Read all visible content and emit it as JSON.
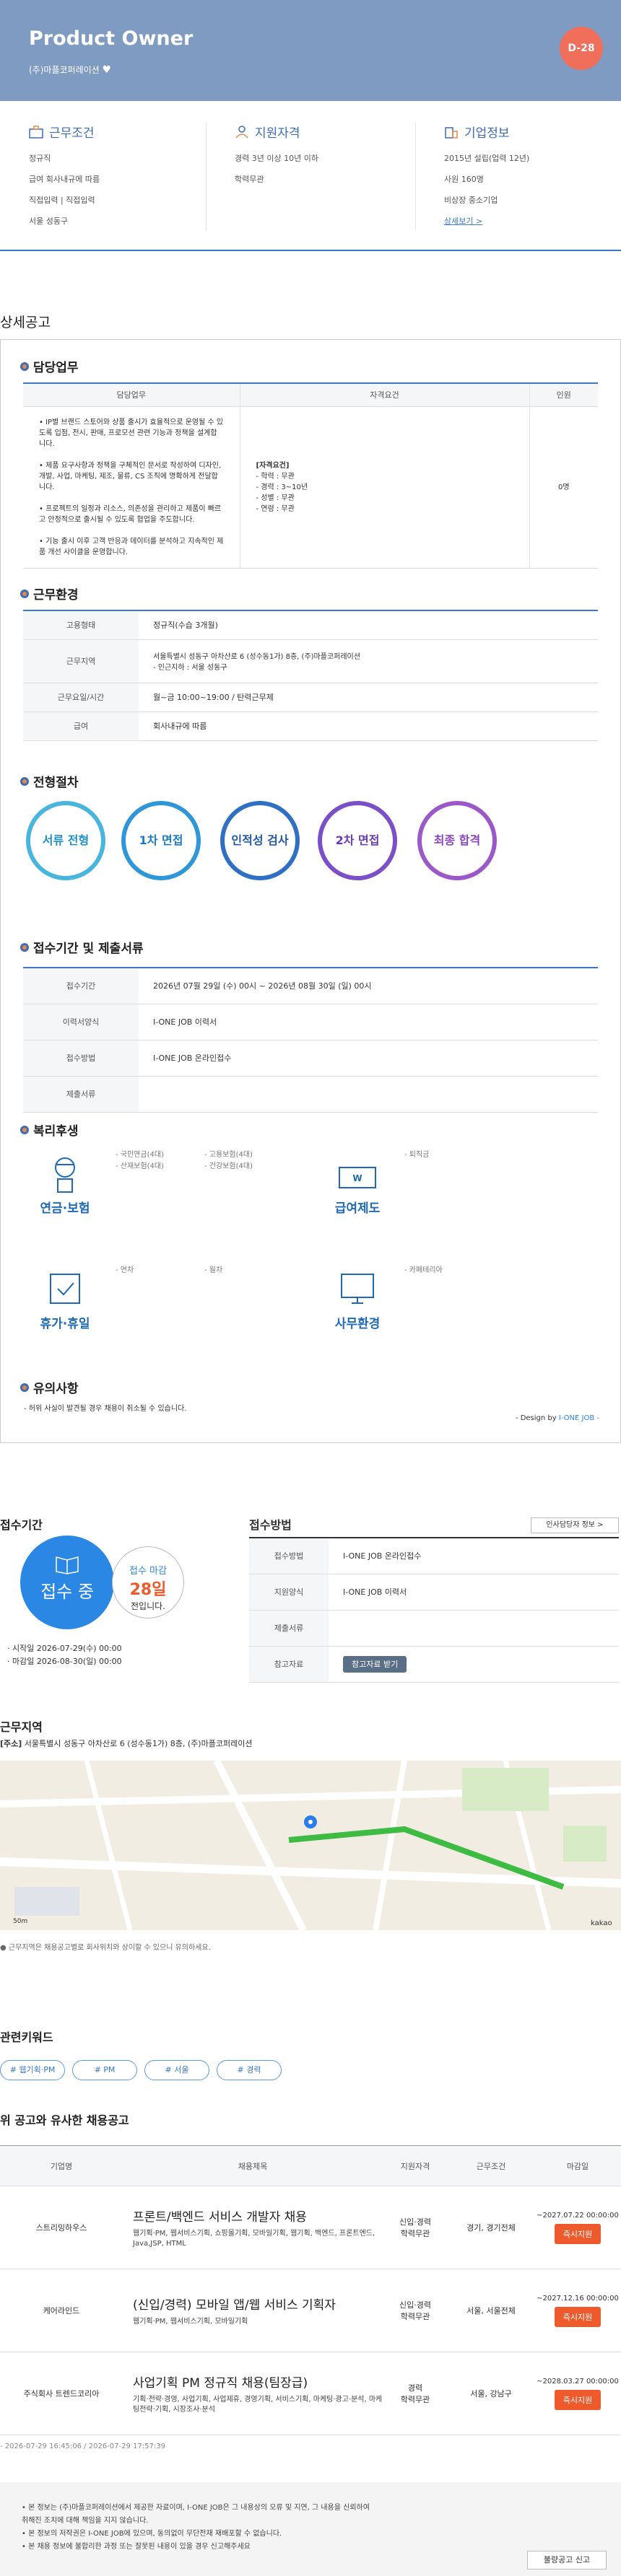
{
  "header": {
    "title": "Product Owner",
    "company": "(주)마플코퍼레이션",
    "dday": "D-28"
  },
  "info": {
    "work": {
      "title": "근무조건",
      "items": [
        "정규직",
        "급여 회사내규에 따름",
        "직접입력 | 직접입력",
        "서울 성동구"
      ]
    },
    "qual": {
      "title": "지원자격",
      "items": [
        "경력 3년 이상 10년 이하",
        "학력무관"
      ]
    },
    "corp": {
      "title": "기업정보",
      "items": [
        "2015년 설립(업력 12년)",
        "사원 160명",
        "비상장 중소기업"
      ],
      "more": "상세보기 >"
    }
  },
  "detail": {
    "heading": "상세공고",
    "duty": {
      "title": "담당업무",
      "headers": [
        "담당업무",
        "자격요건",
        "인원"
      ],
      "task": [
        "• IP별 브랜드 스토어와 상품 출시가 효율적으로 운영될 수 있도록 입점, 전시, 판매, 프로모션 관련 기능과 정책을 설계합니다.",
        "• 제품 요구사항과 정책을 구체적인 문서로 작성하여 디자인, 개발, 사업, 마케팅, 제조, 물류, CS 조직에 명확하게 전달합니다.",
        "• 프로젝트의 일정과 리소스, 의존성을 관리하고 제품이 빠르고 안정적으로 출시될 수 있도록 협업을 주도합니다.",
        "• 기능 출시 이후 고객 반응과 데이터를 분석하고 지속적인 제품 개선 사이클을 운영합니다."
      ],
      "req": [
        "[자격요건]",
        "- 학력 : 무관",
        "- 경력 : 3~10년",
        "- 성별 : 무관",
        "- 연령 : 무관"
      ],
      "count": "0명"
    },
    "env": {
      "title": "근무환경",
      "rows": [
        [
          "고용형태",
          "정규직(수습 3개월)"
        ],
        [
          "근무지역",
          "서울특별시 성동구 아차산로 6 (성수동1가) 8층, (주)마플코퍼레이션\n- 인근지하 : 서울 성동구"
        ],
        [
          "근무요일/시간",
          "월~금 10:00~19:00 / 탄력근무제"
        ],
        [
          "급여",
          "회사내규에 따름"
        ]
      ]
    },
    "process": {
      "title": "전형절차",
      "steps": [
        "서류 전형",
        "1차 면접",
        "인적성 검사",
        "2차 면접",
        "최종 합격"
      ]
    },
    "period": {
      "title": "접수기간 및 제출서류",
      "rows": [
        [
          "접수기간",
          "2026년 07월 29일 (수) 00시 ~ 2026년 08월 30일 (일) 00시"
        ],
        [
          "이력서양식",
          "I-ONE JOB 이력서"
        ],
        [
          "접수방법",
          "I-ONE JOB 온라인접수"
        ],
        [
          "제출서류",
          ""
        ]
      ]
    },
    "welfare": {
      "title": "복리후생",
      "g1": {
        "label": "연금·보험",
        "items": [
          "- 국민연금(4대)",
          "- 산재보험(4대)",
          "- 고용보험(4대)",
          "- 건강보험(4대)"
        ]
      },
      "g2": {
        "label": "급여제도",
        "items": [
          "- 퇴직금"
        ]
      },
      "g3": {
        "label": "휴가·휴일",
        "items": [
          "- 연차",
          "- 월차"
        ]
      },
      "g4": {
        "label": "사무환경",
        "items": [
          "- 카페테리아"
        ]
      }
    },
    "notice": {
      "title": "유의사항",
      "text": "- 허위 사실이 발견될 경우 채용이 취소될 수 있습니다.",
      "design": "- Design by ",
      "design_brand": "I-ONE JOB -"
    }
  },
  "apply": {
    "title": "접수기간",
    "status": "접수 중",
    "deadline_label": "접수 마감",
    "deadline_days": "28일",
    "deadline_suffix": "전입니다.",
    "start": "· 시작일 2026-07-29(수) 00:00",
    "end": "· 마감일 2026-08-30(일) 00:00",
    "method_title": "접수방법",
    "contact_btn": "인사담당자 정보 >",
    "rows": [
      [
        "접수방법",
        "I-ONE JOB 온라인접수"
      ],
      [
        "지원양식",
        "I-ONE JOB 이력서"
      ],
      [
        "제출서류",
        ""
      ],
      [
        "참고자료",
        "참고자료 받기"
      ]
    ]
  },
  "location": {
    "title": "근무지역",
    "address_tag": "[주소]",
    "address": "서울특별시 성동구 아차산로 6 (성수동1가) 8층, (주)마플코퍼레이션",
    "note": "● 근무지역은 채용공고별로 회사위치와 상이할 수 있으니 유의하세요.",
    "scale": "50m",
    "kakao": "kakao"
  },
  "keywords": {
    "title": "관련키워드",
    "items": [
      "# 웹기획·PM",
      "# PM",
      "# 서울",
      "# 경력"
    ]
  },
  "similar": {
    "title": "위 공고와 유사한 채용공고",
    "headers": [
      "기업명",
      "채용제목",
      "지원자격",
      "근무조건",
      "마감일"
    ],
    "rows": [
      {
        "company": "스트리밍하우스",
        "title": "프론트/백엔드 서비스 개발자 채용",
        "tags": "웹기획·PM, 웹서비스기획, 쇼핑몰기획, 모바일기획, 웹기획, 백엔드, 프론트엔드, Java,JSP, HTML",
        "qual": "신입·경력\n학력무관",
        "cond": "경기, 경기전체",
        "date": "~2027.07.22 00:00:00",
        "btn": "즉시지원"
      },
      {
        "company": "케어라인드",
        "title": "(신입/경력) 모바일 앱/웹 서비스 기획자",
        "tags": "웹기획·PM, 웹서비스기획, 모바일기획",
        "qual": "신입·경력\n학력무관",
        "cond": "서울, 서울전체",
        "date": "~2027.12.16 00:00:00",
        "btn": "즉시지원"
      },
      {
        "company": "주식회사 트렌드코리아",
        "title": "사업기획 PM 정규직 채용(팀장급)",
        "tags": "기획·전략·경영, 사업기획, 사업제휴, 경영기획, 서비스기획, 마케팅·광고·분석, 마케팅전략·기획, 시장조사·분석",
        "qual": "경력\n학력무관",
        "cond": "서울, 강남구",
        "date": "~2028.03.27 00:00:00",
        "btn": "즉시지원"
      }
    ]
  },
  "meta": {
    "date": "- 2026-07-29 16:45:06 / 2026-07-29 17:57:39"
  },
  "footer": {
    "lines": [
      "• 본 정보는 (주)마플코퍼레이션에서 제공한 자료이며, I-ONE JOB은 그 내용상의 오류 및 지연, 그 내용을 신뢰하여",
      "  취해진 조치에 대해 책임을 지지 않습니다.",
      "• 본 정보의 저작권은 I-ONE JOB에 있으며, 동의없이 무단전재 재배포할 수 없습니다.",
      "• 본 채용 정보에 불합리한 과정 또는 잘못된 내용이 있을 경우 신고해주세요"
    ],
    "report": "불량공고 신고"
  }
}
